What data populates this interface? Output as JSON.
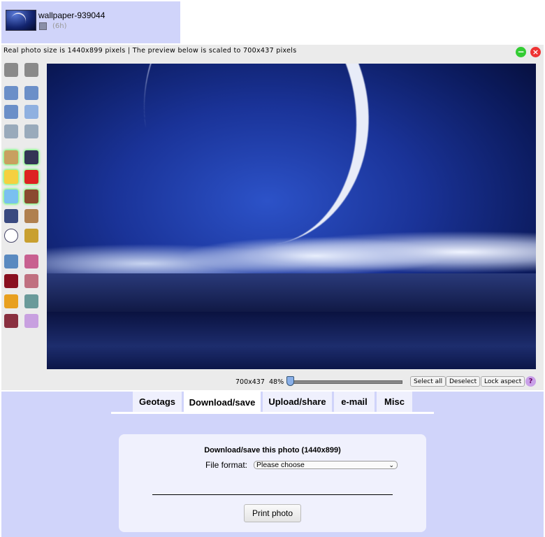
{
  "header": {
    "title": "wallpaper-939044",
    "age": "(6h)"
  },
  "editor": {
    "info": "Real photo size is 1440x899 pixels | The preview below is scaled to 700x437 pixels",
    "minimize": "−",
    "close": "×",
    "tools": [
      "undo",
      "redo",
      "rotate",
      "rotate-left",
      "flip",
      "resize",
      "crop",
      "frame",
      "face",
      "camera",
      "smiley",
      "heart",
      "text",
      "silhouette",
      "poster",
      "photo-frame",
      "speech-bubble",
      "border",
      "adjust",
      "colors",
      "bars",
      "stripes",
      "texture",
      "sharpen",
      "red-eye",
      "overlay"
    ],
    "dimensions": "700x437",
    "zoom": "48%",
    "zoom_value": 48,
    "buttons": {
      "select_all": "Select all",
      "deselect": "Deselect",
      "lock_aspect": "Lock aspect",
      "help": "?"
    }
  },
  "tabs": [
    {
      "label": "Geotags"
    },
    {
      "label": "Download/save",
      "active": true
    },
    {
      "label": "Upload/share"
    },
    {
      "label": "e-mail"
    },
    {
      "label": "Misc"
    }
  ],
  "download": {
    "heading": "Download/save this photo (1440x899)",
    "format_label": "File format:",
    "format_value": "Please choose",
    "print": "Print photo"
  },
  "colors": {
    "panel": "#d0d4fa",
    "toolbar": "#ebebeb"
  }
}
